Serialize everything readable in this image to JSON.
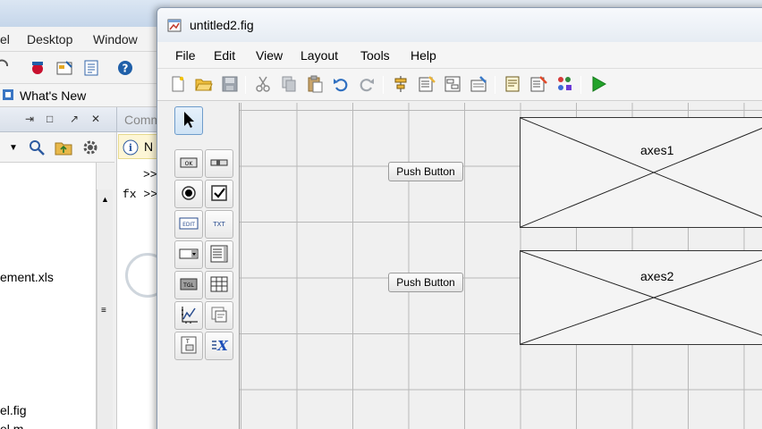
{
  "background_window": {
    "menu": [
      "el",
      "Desktop",
      "Window"
    ],
    "shortcut_label": "What's New",
    "command_tab_label": "Comm",
    "info_bar_text": "N",
    "prompts": [
      ">>",
      "fx  >>"
    ],
    "files": [
      "ement.xls",
      "el.fig",
      "el.m"
    ]
  },
  "window": {
    "title": "untitled2.fig"
  },
  "menubar": {
    "items": [
      "File",
      "Edit",
      "View",
      "Layout",
      "Tools",
      "Help"
    ]
  },
  "toolbar": {
    "icons": [
      "new-file-icon",
      "open-folder-icon",
      "save-icon",
      "cut-icon",
      "copy-icon",
      "paste-icon",
      "undo-icon",
      "redo-icon",
      "align-icon",
      "menu-editor-icon",
      "tab-order-icon",
      "toolbar-editor-icon",
      "editor-icon",
      "property-inspector-icon",
      "object-browser-icon",
      "run-figure-icon"
    ]
  },
  "palette": {
    "icons": [
      "select-icon",
      "push-button-icon",
      "slider-icon",
      "radio-button-icon",
      "checkbox-icon",
      "edit-text-icon",
      "static-text-icon",
      "popup-menu-icon",
      "listbox-icon",
      "toggle-button-icon",
      "table-icon",
      "axes-icon",
      "panel-icon",
      "button-group-icon",
      "activex-icon"
    ],
    "labels": {
      "push": "OK",
      "edit": "EDIT",
      "text": "TXT",
      "toggle": "TGL"
    }
  },
  "layout": {
    "buttons": [
      {
        "label": "Push Button"
      },
      {
        "label": "Push Button"
      }
    ],
    "axes": [
      {
        "label": "axes1"
      },
      {
        "label": "axes2"
      }
    ]
  },
  "colors": {
    "run_green": "#22a32a",
    "selection_blue": "#cfe3f5"
  }
}
